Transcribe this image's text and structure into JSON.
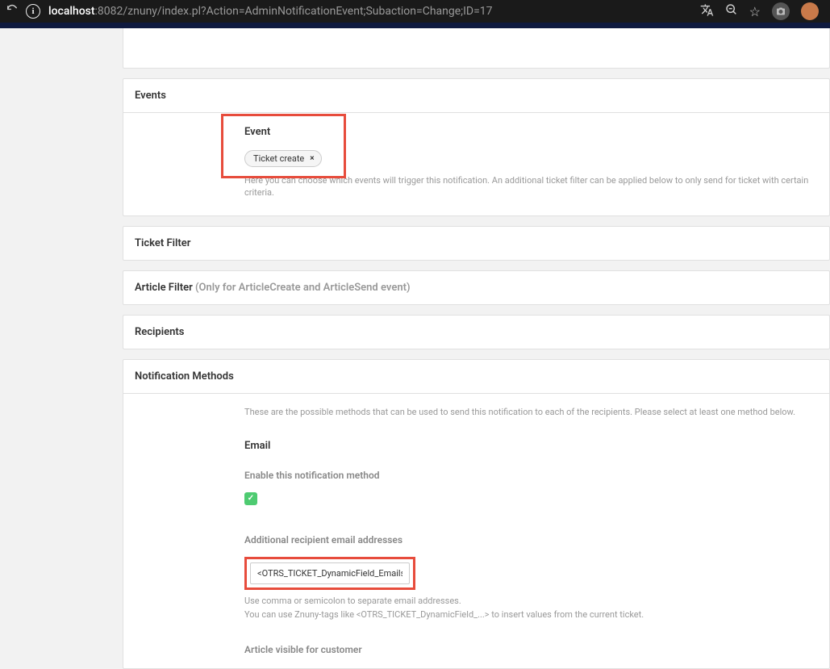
{
  "browser": {
    "url_host": "localhost",
    "url_path": ":8082/znuny/index.pl?Action=AdminNotificationEvent;Subaction=Change;ID=17"
  },
  "sections": {
    "events": {
      "title": "Events",
      "field_label": "Event",
      "tag_label": "Ticket create",
      "tag_remove": "×",
      "help": "Here you can choose which events will trigger this notification. An additional ticket filter can be applied below to only send for ticket with certain criteria."
    },
    "ticket_filter": {
      "title": "Ticket Filter"
    },
    "article_filter": {
      "title": "Article Filter ",
      "note": "(Only for ArticleCreate and ArticleSend event)"
    },
    "recipients": {
      "title": "Recipients"
    },
    "notification_methods": {
      "title": "Notification Methods",
      "intro": "These are the possible methods that can be used to send this notification to each of the recipients. Please select at least one method below.",
      "email_title": "Email",
      "enable_label": "Enable this notification method",
      "additional_label": "Additional recipient email addresses",
      "additional_value": "<OTRS_TICKET_DynamicField_EmailsCC>",
      "help1": "Use comma or semicolon to separate email addresses.",
      "help2": "You can use Znuny-tags like <OTRS_TICKET_DynamicField_...> to insert values from the current ticket.",
      "article_visible": "Article visible for customer"
    }
  }
}
